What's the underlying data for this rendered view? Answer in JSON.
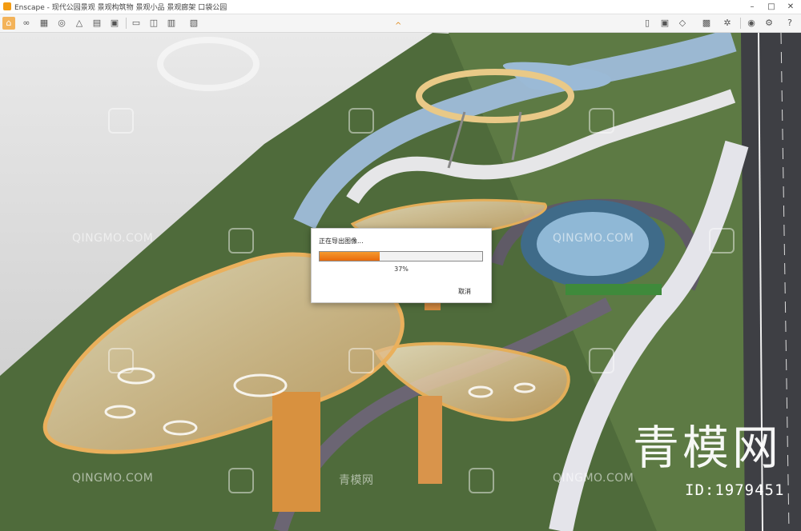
{
  "window": {
    "app_name": "Enscape",
    "title": "Enscape - 现代公园景观 景观构筑物 景观小品 景观廊架 口袋公园",
    "minimize_label": "–",
    "maximize_label": "□",
    "close_label": "✕"
  },
  "toolbar": {
    "left_icons": [
      "home-icon",
      "link-icon",
      "bim-icon",
      "binoculars-icon",
      "bell-icon",
      "grid-icon",
      "clapper-icon",
      "export-image-icon",
      "export-panorama-icon",
      "export-video-icon",
      "export-exe-icon"
    ],
    "right_icons": [
      "book-icon",
      "assets-icon",
      "cube-icon",
      "materials-icon",
      "settings-gear-icon",
      "visibility-icon",
      "gear-icon",
      "help-icon"
    ],
    "help_label": "?",
    "collapse_glyph": "^"
  },
  "dialog": {
    "title": "正在导出图像...",
    "progress_fraction": 0.37,
    "progress_text": "37%",
    "cancel_label": "取消"
  },
  "watermarks": {
    "text": "QINGMO.COM",
    "cn_text": "青模网",
    "brand": "青模网",
    "id": "ID:1979451"
  },
  "colors": {
    "accent": "#f39c12",
    "progress": "#ef7f1a"
  }
}
